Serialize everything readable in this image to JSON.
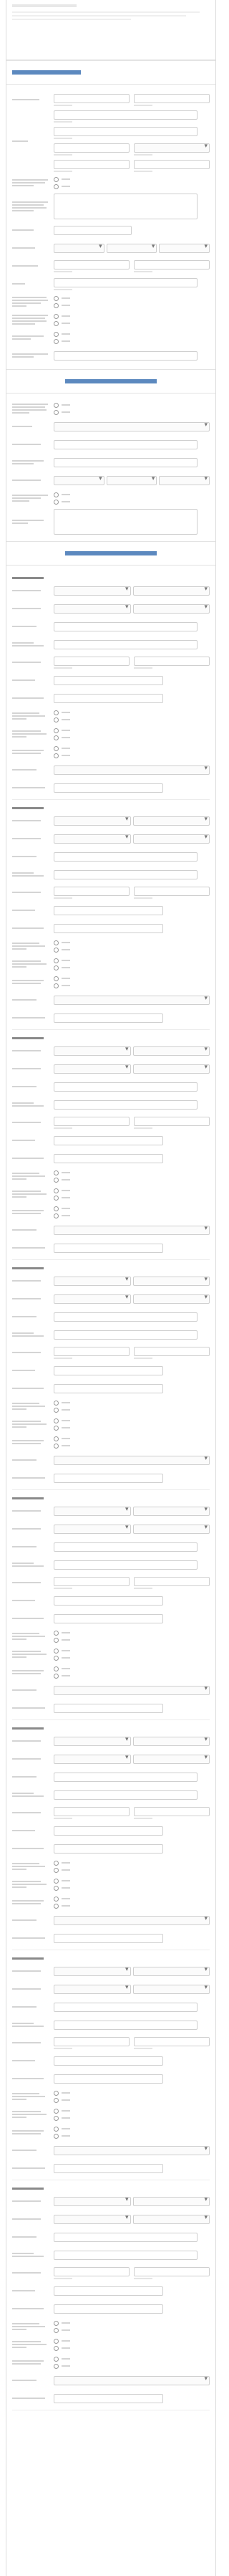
{
  "sections": [
    {
      "id": "general"
    },
    {
      "id": "license"
    },
    {
      "id": "employment"
    }
  ],
  "employment_blocks": [
    1,
    2,
    3,
    4,
    5,
    6,
    7,
    8
  ]
}
